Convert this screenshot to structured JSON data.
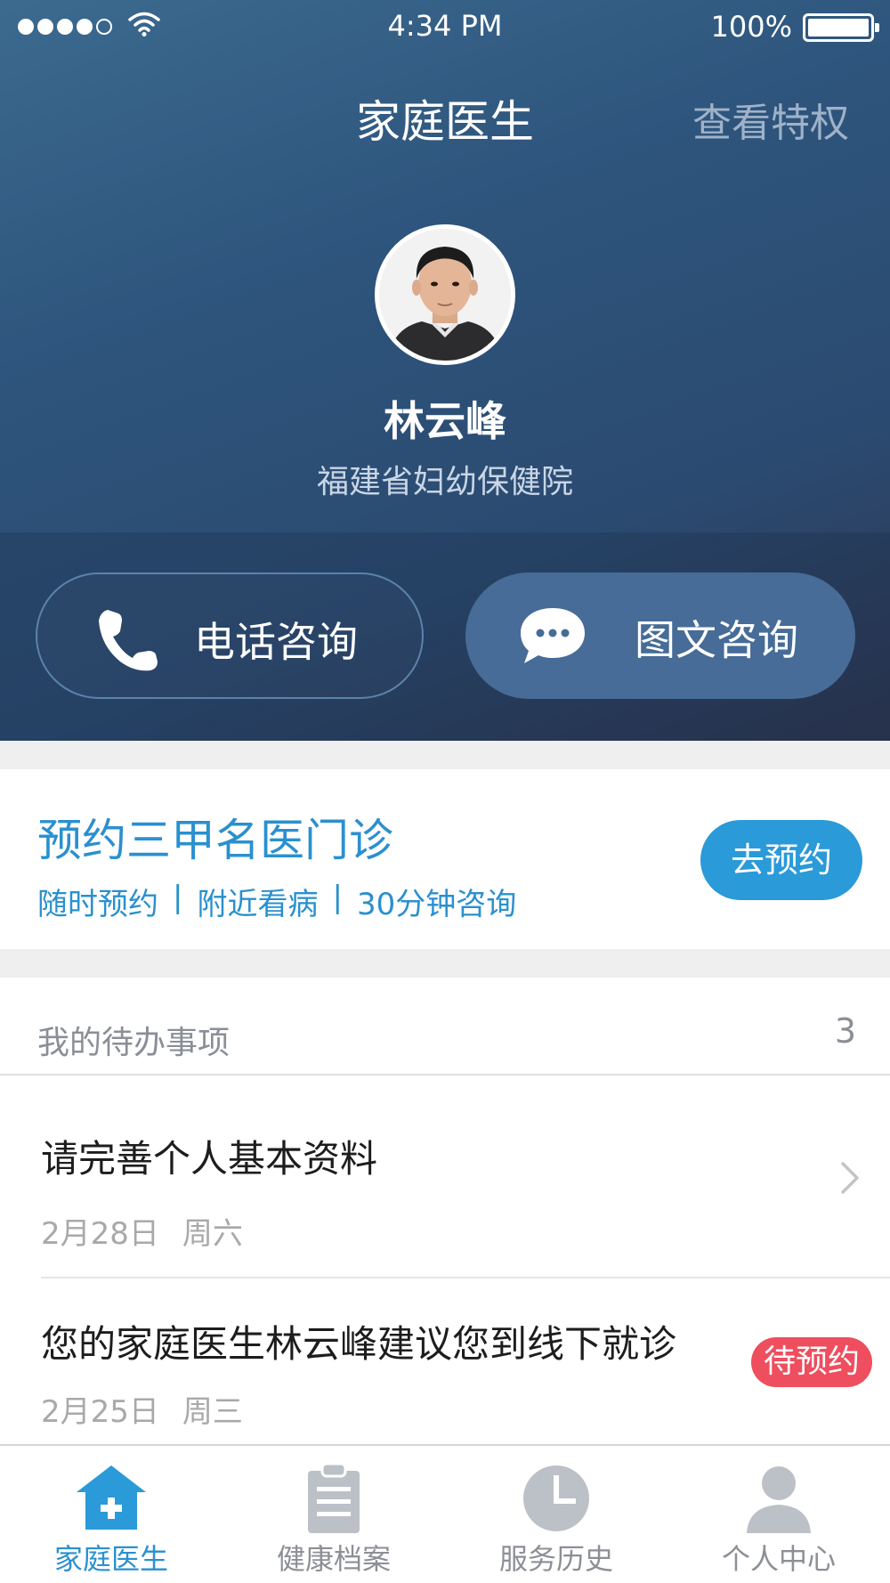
{
  "status_bar": {
    "time": "4:34 PM",
    "battery": "100%",
    "signal_icon": "signal-dots-icon",
    "wifi_icon": "wifi-icon",
    "battery_icon": "battery-icon"
  },
  "nav": {
    "title": "家庭医生",
    "right_action": "查看特权"
  },
  "doctor": {
    "name": "林云峰",
    "hospital": "福建省妇幼保健院",
    "avatar_icon": "doctor-avatar"
  },
  "consult": {
    "call_label": "电话咨询",
    "call_icon": "phone-icon",
    "chat_label": "图文咨询",
    "chat_icon": "chat-bubble-icon"
  },
  "booking": {
    "title": "预约三甲名医门诊",
    "features": [
      "随时预约",
      "|",
      "附近看病",
      "|",
      "30分钟咨询"
    ],
    "button": "去预约"
  },
  "todos": {
    "title": "我的待办事项",
    "count": "3",
    "items": [
      {
        "title": "请完善个人基本资料",
        "date": "2月28日",
        "weekday": "周六"
      },
      {
        "title": "您的家庭医生林云峰建议您到线下就诊",
        "date": "2月25日",
        "weekday": "周三",
        "badge": "待预约"
      }
    ]
  },
  "tabbar": {
    "tabs": [
      {
        "label": "家庭医生",
        "icon": "house-plus-icon"
      },
      {
        "label": "健康档案",
        "icon": "clipboard-icon"
      },
      {
        "label": "服务历史",
        "icon": "clock-icon"
      },
      {
        "label": "个人中心",
        "icon": "person-icon"
      }
    ]
  },
  "colors": {
    "accent": "#2a90cf",
    "badge": "#ee4e5e",
    "header_dark": "#2b4a70"
  }
}
